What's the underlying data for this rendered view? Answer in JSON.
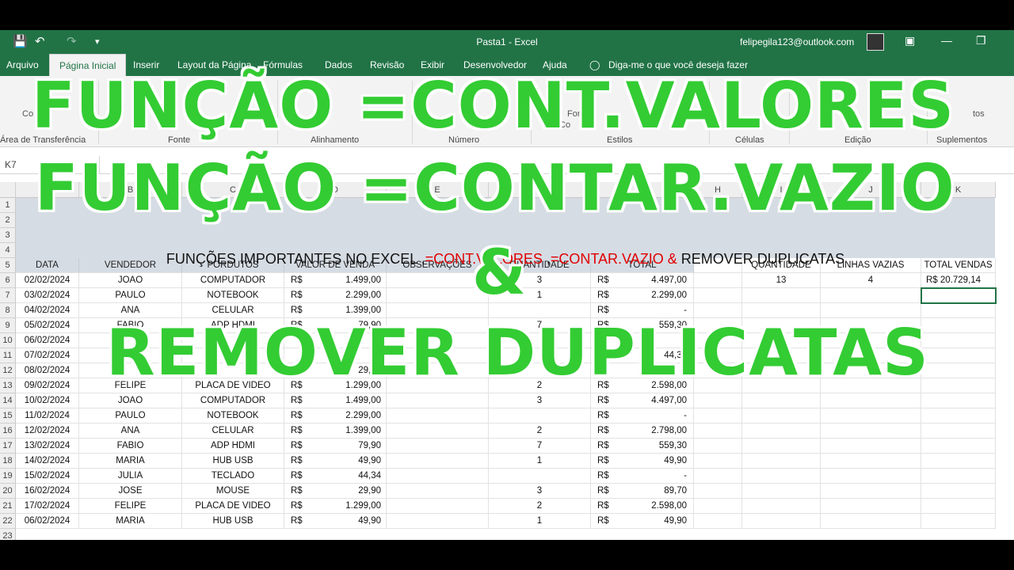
{
  "titlebar": {
    "save_icon": "save-icon",
    "undo_icon": "undo-icon",
    "redo_icon": "redo-icon",
    "title": "Pasta1  -  Excel",
    "user": "felipegila123@outlook.com"
  },
  "menu": {
    "tabs": [
      "Arquivo",
      "Página Inicial",
      "Inserir",
      "Layout da Página",
      "Fórmulas",
      "Dados",
      "Revisão",
      "Exibir",
      "Desenvolvedor",
      "Ajuda"
    ],
    "tell_me": "Diga-me o que você deseja fazer"
  },
  "ribbon": {
    "groups": [
      "Área de Transferência",
      "Fonte",
      "Alinhamento",
      "Número",
      "Estilos",
      "Células",
      "Edição",
      "Suplementos"
    ]
  },
  "formula_bar": {
    "name_box": "K7"
  },
  "sheet": {
    "columns": [
      "A",
      "B",
      "C",
      "D",
      "E",
      "F",
      "G",
      "H",
      "I",
      "J",
      "K"
    ],
    "title_parts": {
      "p1": "FUNÇÕES IMPORTANTES NO EXCEL ,",
      "p2": "=CONT.VALORES",
      "p3": " ,",
      "p4": "=CONTAR.VAZIO &",
      "p5": " REMOVER DUPLICATAS"
    },
    "headers": [
      "DATA",
      "VENDEDOR",
      "PORDUTOS",
      "VALOR DE VENDA",
      "OBSERVAÇÕES",
      "QUANTIDADE",
      "TOTAL",
      "",
      "QUANTIDADE",
      "LINHAS VAZIAS",
      "TOTAL VENDAS"
    ],
    "currency": "R$",
    "rows": [
      {
        "n": "6",
        "date": "02/02/2024",
        "seller": "JOAO",
        "product": "COMPUTADOR",
        "value": "1.499,00",
        "qty": "3",
        "total": "4.497,00"
      },
      {
        "n": "7",
        "date": "03/02/2024",
        "seller": "PAULO",
        "product": "NOTEBOOK",
        "value": "2.299,00",
        "qty": "1",
        "total": "2.299,00"
      },
      {
        "n": "8",
        "date": "04/02/2024",
        "seller": "ANA",
        "product": "CELULAR",
        "value": "1.399,00",
        "qty": "",
        "total": "-"
      },
      {
        "n": "9",
        "date": "05/02/2024",
        "seller": "FABIO",
        "product": "ADP HDMI",
        "value": "79,90",
        "qty": "7",
        "total": "559,30"
      },
      {
        "n": "10",
        "date": "06/02/2024",
        "seller": "",
        "product": "",
        "value": "",
        "qty": "",
        "total": "-"
      },
      {
        "n": "11",
        "date": "07/02/2024",
        "seller": "",
        "product": "",
        "value": "",
        "qty": "",
        "total": "44,34"
      },
      {
        "n": "12",
        "date": "08/02/2024",
        "seller": "",
        "product": "",
        "value": "29,90",
        "qty": "",
        "total": ""
      },
      {
        "n": "13",
        "date": "09/02/2024",
        "seller": "FELIPE",
        "product": "PLACA DE VIDEO",
        "value": "1.299,00",
        "qty": "2",
        "total": "2.598,00"
      },
      {
        "n": "14",
        "date": "10/02/2024",
        "seller": "JOAO",
        "product": "COMPUTADOR",
        "value": "1.499,00",
        "qty": "3",
        "total": "4.497,00"
      },
      {
        "n": "15",
        "date": "11/02/2024",
        "seller": "PAULO",
        "product": "NOTEBOOK",
        "value": "2.299,00",
        "qty": "",
        "total": "-"
      },
      {
        "n": "16",
        "date": "12/02/2024",
        "seller": "ANA",
        "product": "CELULAR",
        "value": "1.399,00",
        "qty": "2",
        "total": "2.798,00"
      },
      {
        "n": "17",
        "date": "13/02/2024",
        "seller": "FABIO",
        "product": "ADP HDMI",
        "value": "79,90",
        "qty": "7",
        "total": "559,30"
      },
      {
        "n": "18",
        "date": "14/02/2024",
        "seller": "MARIA",
        "product": "HUB USB",
        "value": "49,90",
        "qty": "1",
        "total": "49,90"
      },
      {
        "n": "19",
        "date": "15/02/2024",
        "seller": "JULIA",
        "product": "TECLADO",
        "value": "44,34",
        "qty": "",
        "total": "-"
      },
      {
        "n": "20",
        "date": "16/02/2024",
        "seller": "JOSE",
        "product": "MOUSE",
        "value": "29,90",
        "qty": "3",
        "total": "89,70"
      },
      {
        "n": "21",
        "date": "17/02/2024",
        "seller": "FELIPE",
        "product": "PLACA DE VIDEO",
        "value": "1.299,00",
        "qty": "2",
        "total": "2.598,00"
      },
      {
        "n": "22",
        "date": "06/02/2024",
        "seller": "MARIA",
        "product": "HUB USB",
        "value": "49,90",
        "qty": "1",
        "total": "49,90"
      }
    ],
    "summary": {
      "quantidade": "13",
      "linhas_vazias": "4",
      "total_vendas": "R$  20.729,14"
    }
  },
  "overlay": {
    "line1": "FUNÇÃO =CONT.VALORES",
    "line2": "FUNÇÃO =CONTAR.VAZIO",
    "line3": "&",
    "line4": "REMOVER DUPLICATAS"
  }
}
